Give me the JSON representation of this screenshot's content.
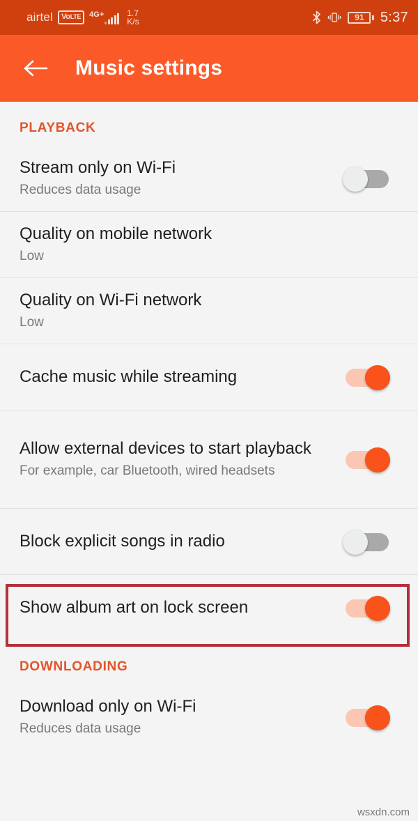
{
  "status_bar": {
    "carrier": "airtel",
    "volte_main": "Vo",
    "volte_sub": "LTE",
    "network_type": "4G+",
    "data_speed_value": "1.7",
    "data_speed_unit": "K/s",
    "bluetooth_icon": "bluetooth-icon",
    "vibrate_icon": "vibrate-icon",
    "battery_level": "91",
    "time": "5:37"
  },
  "app_bar": {
    "back_icon": "back-arrow-icon",
    "title": "Music settings",
    "background_color": "#fb5a28"
  },
  "sections": [
    {
      "header": "PLAYBACK",
      "items": [
        {
          "title": "Stream only on Wi-Fi",
          "subtitle": "Reduces data usage",
          "control": "toggle",
          "state": "off"
        },
        {
          "title": "Quality on mobile network",
          "subtitle": "Low",
          "control": "none",
          "state": ""
        },
        {
          "title": "Quality on Wi-Fi network",
          "subtitle": "Low",
          "control": "none",
          "state": ""
        },
        {
          "title": "Cache music while streaming",
          "subtitle": "",
          "control": "toggle",
          "state": "on"
        },
        {
          "title": "Allow external devices to start playback",
          "subtitle": "For example, car Bluetooth, wired headsets",
          "control": "toggle",
          "state": "on"
        },
        {
          "title": "Block explicit songs in radio",
          "subtitle": "",
          "control": "toggle",
          "state": "off",
          "highlighted": true
        },
        {
          "title": "Show album art on lock screen",
          "subtitle": "",
          "control": "toggle",
          "state": "on"
        }
      ]
    },
    {
      "header": "DOWNLOADING",
      "items": [
        {
          "title": "Download only on Wi-Fi",
          "subtitle": "Reduces data usage",
          "control": "toggle",
          "state": "on"
        }
      ]
    }
  ],
  "highlight": {
    "color": "#b5303c",
    "target": "Block explicit songs in radio"
  },
  "watermark": "wsxdn.com",
  "colors": {
    "status_bar": "#d0400f",
    "app_bar": "#fb5a28",
    "section_header": "#e2552b",
    "toggle_on": "#f9521a",
    "toggle_on_track": "#fbc6b2",
    "toggle_off_track": "#a9a9a9",
    "background": "#f4f4f4"
  }
}
